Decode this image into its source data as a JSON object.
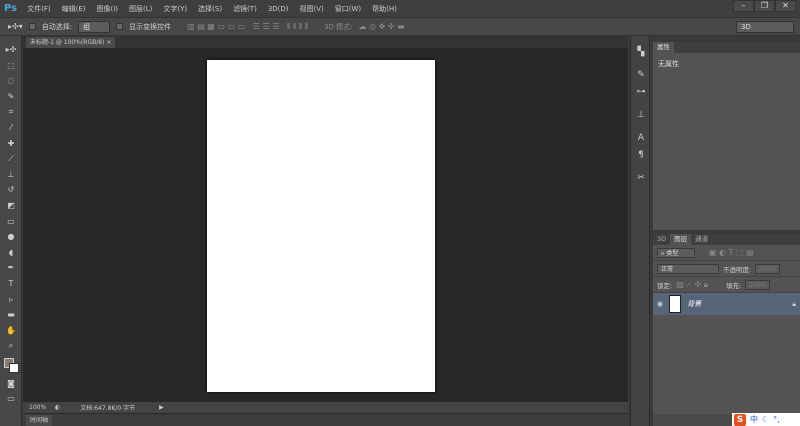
{
  "app": {
    "logo": "Ps"
  },
  "menu": [
    "文件(F)",
    "编辑(E)",
    "图像(I)",
    "图层(L)",
    "文字(Y)",
    "选择(S)",
    "滤镜(T)",
    "3D(D)",
    "视图(V)",
    "窗口(W)",
    "帮助(H)"
  ],
  "window_buttons": [
    "minimize",
    "restore",
    "close"
  ],
  "options": {
    "auto_select_label": "自动选择:",
    "auto_select_value": "组",
    "show_transform_label": "显示变换控件",
    "mode_3d_label": "3D 模式:",
    "workspace_value": "3D"
  },
  "document": {
    "tab_title": "未标题-1 @ 100%(RGB/8)",
    "zoom": "100%",
    "doc_info": "文档:647.8K/0 字节"
  },
  "timeline": {
    "label": "时间轴"
  },
  "tools": [
    "move",
    "marquee",
    "lasso",
    "quick-select",
    "crop",
    "eyedropper",
    "healing",
    "brush",
    "clone-stamp",
    "history-brush",
    "eraser",
    "gradient",
    "blur",
    "dodge",
    "pen",
    "type",
    "path-select",
    "rectangle",
    "hand",
    "zoom"
  ],
  "properties": {
    "tab": "属性",
    "content": "无属性"
  },
  "layers": {
    "tabs": [
      "3D",
      "图层",
      "通道"
    ],
    "active_tab": "图层",
    "filter_kind": "类型",
    "blend_mode": "正常",
    "opacity_label": "不透明度:",
    "opacity": "100%",
    "lock_label": "锁定:",
    "fill_label": "填充:",
    "fill": "100%",
    "items": [
      {
        "name": "背景",
        "locked": true,
        "visible": true
      }
    ]
  },
  "ime": {
    "mode": "中"
  },
  "colors": {
    "accent": "#4aa3df",
    "layer_selected": "#56657a",
    "canvas_bg": "#282828"
  }
}
